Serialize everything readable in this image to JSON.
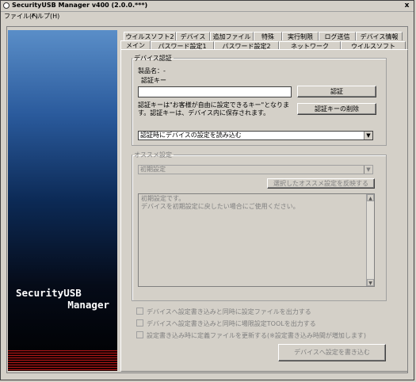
{
  "window": {
    "title": "SecurityUSB Manager v400 (2.0.0.***)",
    "close_label": "x"
  },
  "menu": {
    "file": "ファイル(F)",
    "help": "ヘルプ(H)"
  },
  "sidebar": {
    "brand_line1": "SecurityUSB",
    "brand_line2": "Manager"
  },
  "tabs": {
    "row1": [
      "ウイルスソフト2",
      "デバイス",
      "追加ファイル",
      "特殊",
      "実行制限",
      "ログ送信",
      "デバイス情報"
    ],
    "row2": [
      "メイン",
      "パスワード設定1",
      "パスワード設定2",
      "ネットワーク",
      "ウイルスソフト"
    ]
  },
  "device_auth": {
    "legend": "デバイス認証",
    "product_name": "製品名：-",
    "auth_key_label": "認証キー",
    "auth_key_value": "",
    "auth_button": "認証",
    "note": "認証キーは\"お客様が自由に設定できるキー\"となります。認証キーは、デバイス内に保存されます。",
    "delete_key_button": "認証キーの削除",
    "load_select_value": "認証時にデバイスの設定を読み込む"
  },
  "recommended": {
    "legend": "オススメ設定",
    "select_value": "初期設定",
    "apply_button": "選択したオススメ設定を反映する",
    "description_line1": "初期設定です。",
    "description_line2": "デバイスを初期設定に戻したい場合にご使用ください。"
  },
  "options": {
    "opt1": "デバイスへ設定書き込みと同時に設定ファイルを出力する",
    "opt2": "デバイスへ設定書き込みと同時に場限設定TOOLを出力する",
    "opt3": "設定書き込み時に定義ファイルを更新する(※設定書き込み時間が増加します)"
  },
  "write_button": "デバイスへ設定を書き込む",
  "colors": {
    "chrome": "#d4d0c8",
    "sidebar_top": "#5a8ec8",
    "sidebar_bottom": "#000000",
    "stripe_red": "#b01818"
  }
}
